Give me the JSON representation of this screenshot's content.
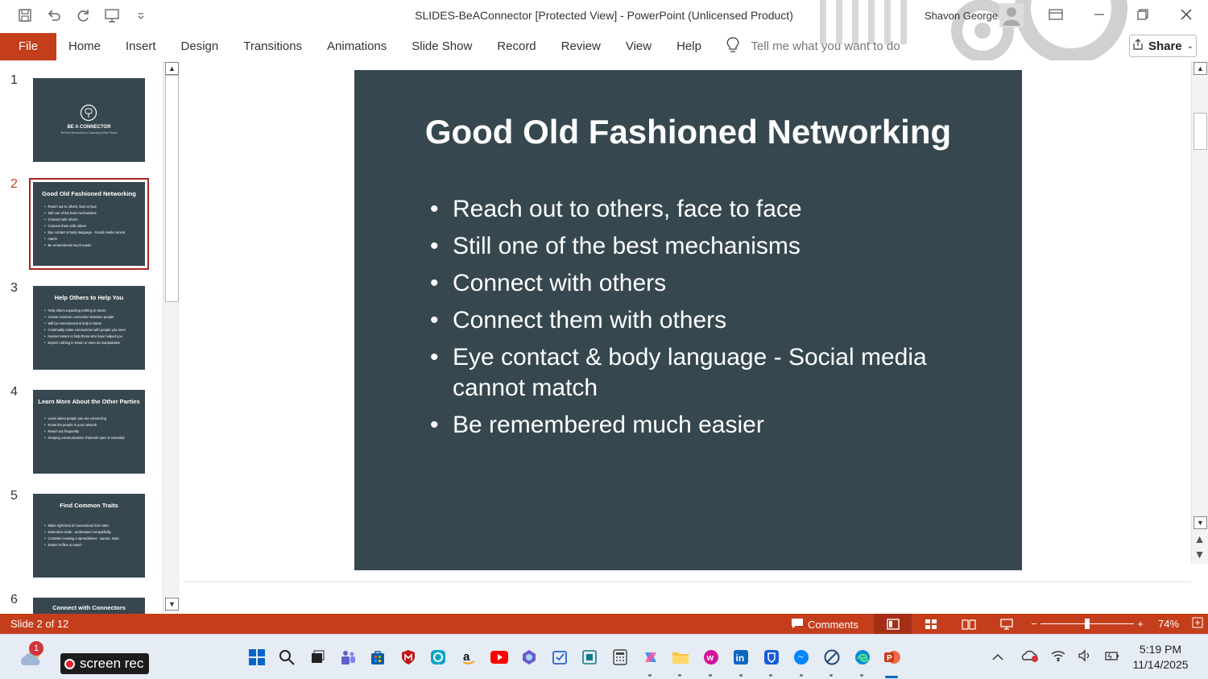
{
  "window": {
    "title": "SLIDES-BeAConnector [Protected View]  -  PowerPoint (Unlicensed Product)",
    "user_name": "Shavon George"
  },
  "ribbon": {
    "tabs": [
      "File",
      "Home",
      "Insert",
      "Design",
      "Transitions",
      "Animations",
      "Slide Show",
      "Record",
      "Review",
      "View",
      "Help"
    ],
    "tell_me_placeholder": "Tell me what you want to do",
    "share_label": "Share"
  },
  "thumbnails": [
    {
      "num": "1",
      "title": "BE A CONNECTOR",
      "subtitle": "Be More Memorable by Connecting Other People",
      "bullets": []
    },
    {
      "num": "2",
      "title": "Good Old Fashioned Networking",
      "bullets": [
        "Reach out to others, face to face",
        "Still one of the best mechanisms",
        "Connect with others",
        "Connect them with others",
        "Eye contact & body language - Social media cannot",
        "match",
        "Be remembered much easier"
      ]
    },
    {
      "num": "3",
      "title": "Help Others to Help You",
      "bullets": [
        "Help others expecting nothing in return",
        "Create common connection between people",
        "Will be remembered & help in future",
        "Continually make connections with people you meet",
        "Human nature to help those who have helped you",
        "Expect nothing in return or seen as manipulative"
      ]
    },
    {
      "num": "4",
      "title": "Learn More About the Other Parties",
      "bullets": [
        "Learn about people you are connecting",
        "Know the people in your network",
        "Reach out frequently",
        "Keeping communication channels open is essential"
      ]
    },
    {
      "num": "5",
      "title": "Find Common Traits",
      "bullets": [
        "Make right kind of connections from start",
        "Determine traits - understand compatibility",
        "Consider creating a spreadsheet - names, traits",
        "Easier to filter & match"
      ]
    },
    {
      "num": "6",
      "title": "Connect with Connectors",
      "bullets": []
    }
  ],
  "slide": {
    "title": "Good Old Fashioned Networking",
    "bullets": [
      "Reach out to others, face to face",
      "Still one of the best mechanisms",
      "Connect with others",
      "Connect them with others",
      "Eye contact & body language - Social media cannot match",
      "Be remembered much easier"
    ]
  },
  "status": {
    "slide_info": "Slide 2 of 12",
    "comments_label": "Comments",
    "zoom": "74%"
  },
  "taskbar": {
    "badge": "1",
    "screenrec_label": "screen rec",
    "time": "5:19 PM",
    "date": "11/14/2025"
  },
  "colors": {
    "accent": "#c43e1c",
    "slide_bg": "#36474f",
    "active_thumb_border": "#a52622"
  }
}
